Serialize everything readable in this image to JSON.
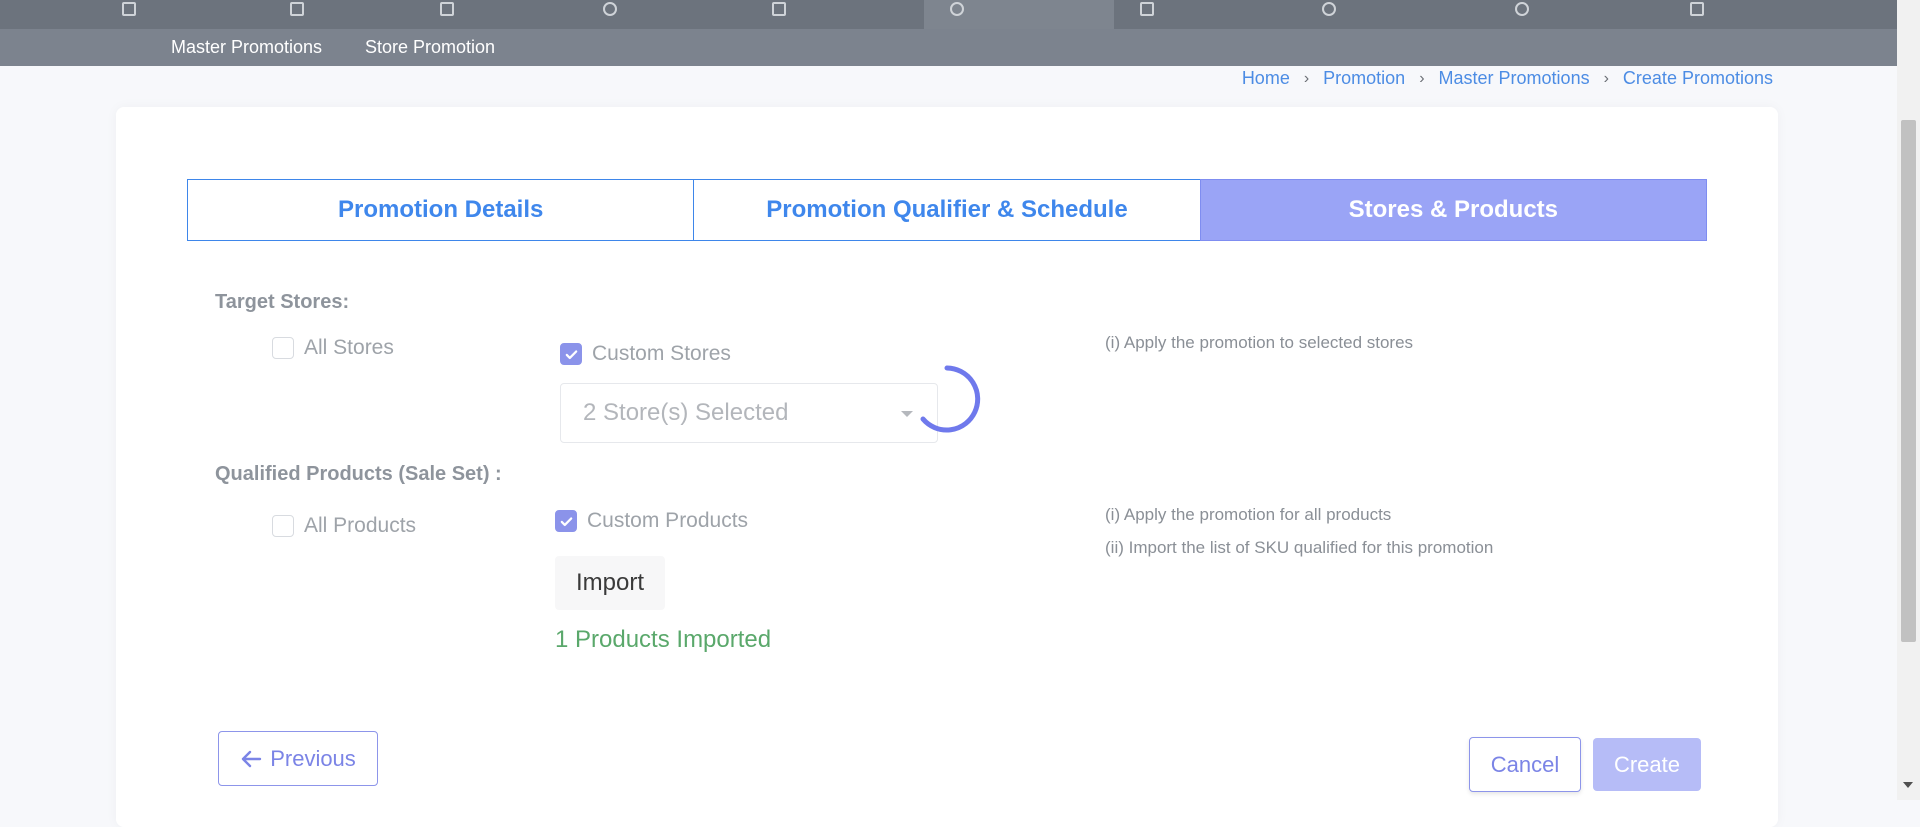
{
  "subnav": {
    "items": [
      "Master Promotions",
      "Store Promotion"
    ]
  },
  "breadcrumb": {
    "items": [
      "Home",
      "Promotion",
      "Master Promotions",
      "Create Promotions"
    ]
  },
  "tabs": [
    {
      "label": "Promotion Details",
      "active": false
    },
    {
      "label": "Promotion Qualifier & Schedule",
      "active": false
    },
    {
      "label": "Stores & Products",
      "active": true
    }
  ],
  "target_stores": {
    "label": "Target Stores:",
    "all_label": "All Stores",
    "all_checked": false,
    "custom_label": "Custom Stores",
    "custom_checked": true,
    "select_value": "2 Store(s) Selected",
    "hint": "(i) Apply the promotion to selected stores"
  },
  "qualified_products": {
    "label": "Qualified Products (Sale Set) :",
    "all_label": "All Products",
    "all_checked": false,
    "custom_label": "Custom Products",
    "custom_checked": true,
    "import_label": "Import",
    "imported_text": "1 Products Imported",
    "hint_1": "(i) Apply the promotion for all products",
    "hint_2": "(ii) Import the list of SKU qualified for this promotion"
  },
  "actions": {
    "previous": "Previous",
    "cancel": "Cancel",
    "create": "Create"
  },
  "colors": {
    "accent": "#8b93ea",
    "link": "#4c8ce4",
    "success": "#5aa86b",
    "nav": "#7c838e"
  }
}
